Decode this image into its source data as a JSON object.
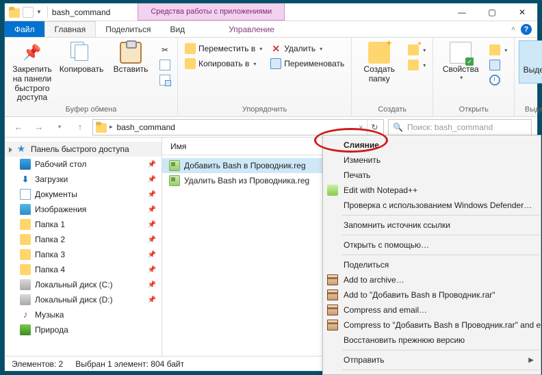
{
  "titlebar": {
    "title": "bash_command",
    "ctx_tool": "Средства работы с приложениями"
  },
  "tabs": {
    "file": "Файл",
    "home": "Главная",
    "share": "Поделиться",
    "view": "Вид",
    "ctx": "Управление"
  },
  "ribbon": {
    "clipboard": {
      "label": "Буфер обмена",
      "pin": "Закрепить на панели\nбыстрого доступа",
      "copy": "Копировать",
      "paste": "Вставить"
    },
    "organize": {
      "label": "Упорядочить",
      "move": "Переместить в",
      "copyto": "Копировать в",
      "del": "Удалить",
      "rename": "Переименовать"
    },
    "new": {
      "label": "Создать",
      "newfolder": "Создать\nпапку"
    },
    "open": {
      "label": "Открыть",
      "props": "Свойства"
    },
    "select": {
      "label": "Выделить",
      "selbtn": "Выделить"
    }
  },
  "addr": {
    "folder": "bash_command",
    "refresh": "↻"
  },
  "search": {
    "placeholder": "Поиск: bash_command"
  },
  "side": {
    "quick": "Панель быстрого доступа",
    "desktop": "Рабочий стол",
    "downloads": "Загрузки",
    "documents": "Документы",
    "pictures": "Изображения",
    "f1": "Папка 1",
    "f2": "Папка 2",
    "f3": "Папка 3",
    "f4": "Папка 4",
    "c": "Локальный диск (C:)",
    "d": "Локальный диск (D:)",
    "music": "Музыка",
    "nature": "Природа"
  },
  "list": {
    "col_name": "Имя",
    "file1": "Добавить Bash в Проводник.reg",
    "file2": "Удалить Bash из Проводника.reg"
  },
  "status": {
    "count": "Элементов: 2",
    "sel": "Выбран 1 элемент: 804 байт"
  },
  "menu": {
    "merge": "Слияние",
    "edit": "Изменить",
    "print": "Печать",
    "npp": "Edit with Notepad++",
    "defender": "Проверка с использованием Windows Defender…",
    "remember": "Запомнить источник ссылки",
    "openwith": "Открыть с помощью…",
    "share": "Поделиться",
    "addarch": "Add to archive…",
    "addrar": "Add to \"Добавить Bash в Проводник.rar\"",
    "cemail": "Compress and email…",
    "cemailto": "Compress to \"Добавить Bash в Проводник.rar\" and ema",
    "restore": "Восстановить прежнюю версию",
    "send": "Отправить"
  }
}
